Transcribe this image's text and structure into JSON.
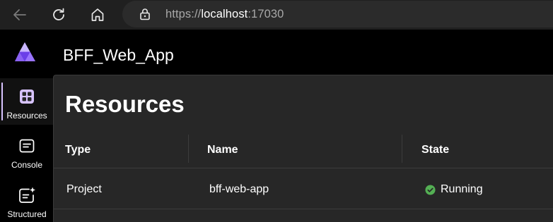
{
  "browser": {
    "back_icon": "back-arrow-icon",
    "reload_icon": "reload-icon",
    "home_icon": "home-icon",
    "lock_icon": "lock-icon",
    "url_scheme": "https://",
    "url_host": "localhost",
    "url_port": ":17030"
  },
  "app": {
    "logo_icon": "aspire-logo-icon",
    "title": "BFF_Web_App"
  },
  "sidebar": {
    "items": [
      {
        "label": "Resources",
        "icon": "resources-grid-icon",
        "active": true
      },
      {
        "label": "Console",
        "icon": "console-icon",
        "active": false
      },
      {
        "label": "Structured",
        "icon": "structured-logs-icon",
        "active": false
      }
    ]
  },
  "main": {
    "title": "Resources",
    "columns": [
      "Type",
      "Name",
      "State"
    ],
    "rows": [
      {
        "type": "Project",
        "name": "bff-web-app",
        "state": "Running",
        "state_icon": "check-circle-icon"
      }
    ]
  },
  "colors": {
    "accent": "#d8c4ff",
    "running": "#54b054",
    "panel": "#272727"
  }
}
